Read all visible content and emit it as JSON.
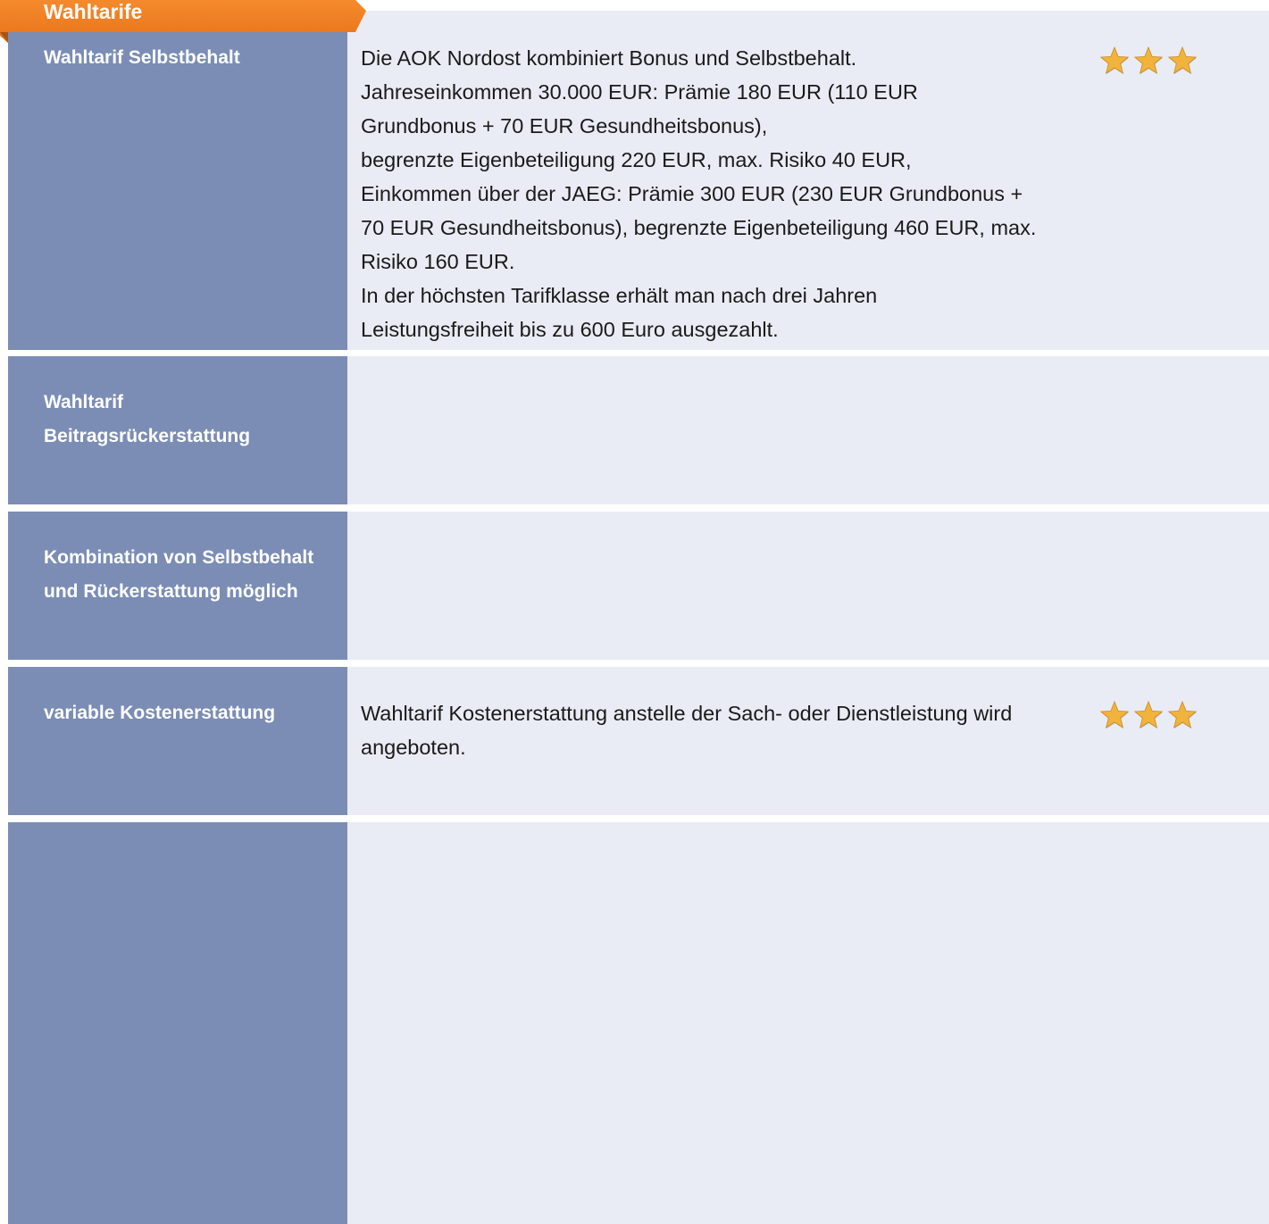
{
  "section": {
    "title": "Wahltarife",
    "accent_color": "#f07d22"
  },
  "rows": [
    {
      "label": "Wahltarif Selbstbehalt",
      "lines": [
        "Die AOK Nordost kombiniert Bonus und Selbstbehalt.",
        "Jahreseinkommen 30.000 EUR: Prämie 180 EUR (110 EUR",
        "Grundbonus + 70 EUR Gesundheitsbonus),",
        "begrenzte Eigenbeteiligung 220 EUR, max. Risiko 40 EUR,",
        "Einkommen über der JAEG: Prämie 300 EUR (230 EUR Grundbonus +",
        "70 EUR Gesundheitsbonus), begrenzte Eigenbeteiligung 460 EUR, max.",
        "Risiko 160 EUR.",
        "In der höchsten Tarifklasse erhält man nach drei Jahren",
        "Leistungsfreiheit bis zu 600 Euro ausgezahlt."
      ],
      "rating": 3
    },
    {
      "label_lines": [
        "Wahltarif",
        "Beitragsrückerstattung"
      ]
    },
    {
      "label_lines": [
        "Kombination von Selbstbehalt",
        "und Rückerstattung möglich"
      ]
    },
    {
      "label": "variable Kostenerstattung",
      "lines": [
        "Wahltarif Kostenerstattung anstelle der Sach- oder Dienstleistung wird",
        "angeboten."
      ],
      "rating": 3
    }
  ],
  "colors": {
    "label_bg": "#7b8db5",
    "content_bg": "#e9ecf4",
    "star": "#f2b33d"
  }
}
